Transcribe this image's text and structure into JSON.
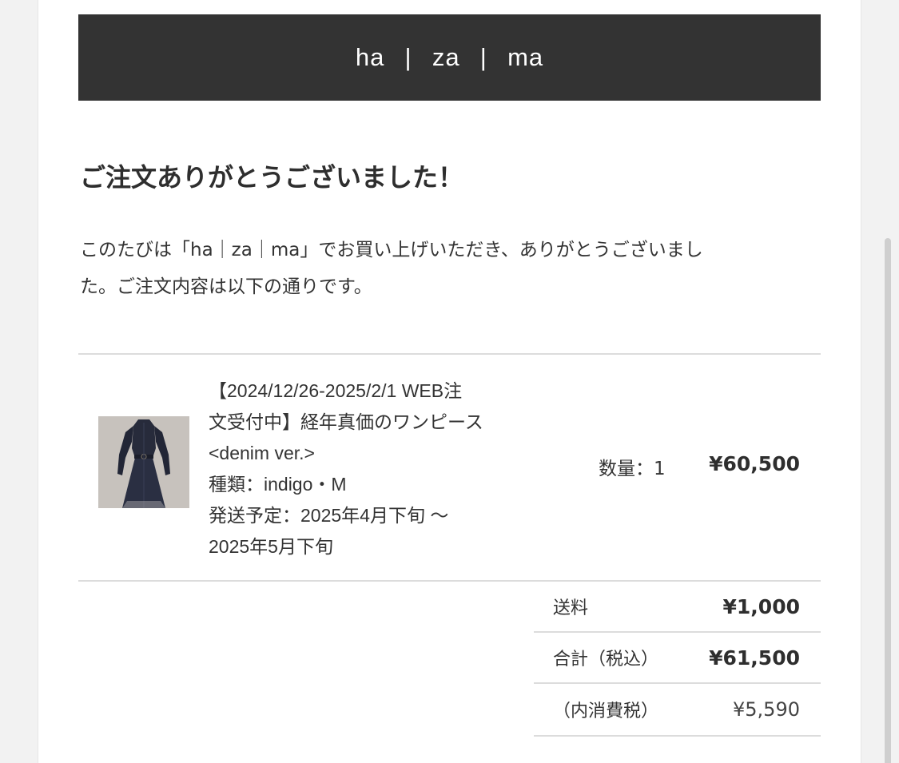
{
  "brand": {
    "name": "ha  |  za  |  ma"
  },
  "heading": "ご注文ありがとうございました！",
  "message": {
    "line1": "このたびは「ha｜za｜ma」でお買い上げいただき、ありがとうございまし",
    "line2": "た。ご注文内容は以下の通りです。"
  },
  "order_item": {
    "image_icon": "dress-photo",
    "name_line1": "【2024/12/26-2025/2/1 WEB注",
    "name_line2": "文受付中】経年真価のワンピース",
    "name_line3": "<denim ver.>",
    "variant": "種類：indigo・M",
    "ship_line1": "発送予定：2025年4月下旬 〜",
    "ship_line2": "2025年5月下旬",
    "quantity": "数量：1",
    "price": "¥60,500"
  },
  "summary": {
    "shipping_label": "送料",
    "shipping_value": "¥1,000",
    "total_label": "合計（税込）",
    "total_value": "¥61,500",
    "tax_label": "（内消費税）",
    "tax_value": "¥5,590"
  },
  "colors": {
    "brand_bar": "#333333",
    "background": "#f2f2f2",
    "divider": "#dcdcdc"
  }
}
